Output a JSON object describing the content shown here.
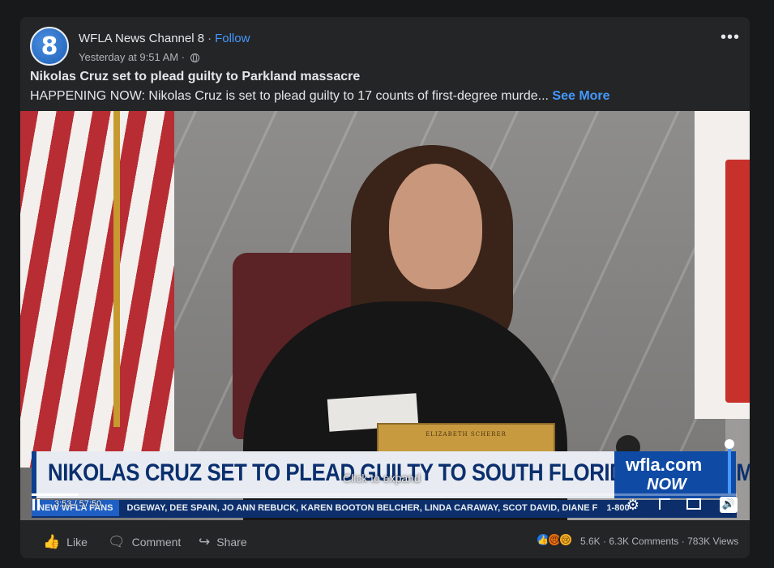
{
  "post": {
    "page_name": "WFLA News Channel 8",
    "separator": "·",
    "follow_label": "Follow",
    "timestamp": "Yesterday at 9:51 AM",
    "meta_sep": "·",
    "avatar_text": "8",
    "more_label": "•••",
    "title": "Nikolas Cruz set to plead guilty to Parkland massacre",
    "description": "HAPPENING NOW: Nikolas Cruz is set to plead guilty to 17 counts of first-degree murde...",
    "see_more": "See More"
  },
  "video": {
    "nameplate": "ELIZABETH SCHERER",
    "headline": "NIKOLAS CRUZ SET TO PLEAD GUILTY TO SOUTH FLORIDA SCHOOL MASSACRE",
    "brand_logo": "wfla.com",
    "brand_now": "NOW",
    "ticker_tag": "NEW WFLA FANS",
    "ticker_names": "DGEWAY, DEE SPAIN, JO ANN REBUCK, KAREN BOOTON BELCHER, LINDA CARAWAY, SCOT DAVID, DIANE F",
    "ticker_phone": "1-800",
    "expand_label": "Click to expand",
    "time": "3:53 / 57:50",
    "progress": 0.067,
    "volume": 1.0
  },
  "actions": {
    "like": "Like",
    "comment": "Comment",
    "share": "Share"
  },
  "stats": {
    "reactions": "5.6K",
    "comments": "6.3K Comments",
    "sep": "·",
    "views": "783K Views"
  },
  "colors": {
    "background": "#18191a",
    "card": "#242526",
    "link": "#4599ff",
    "text": "#e4e6eb",
    "muted": "#b0b3b8"
  }
}
